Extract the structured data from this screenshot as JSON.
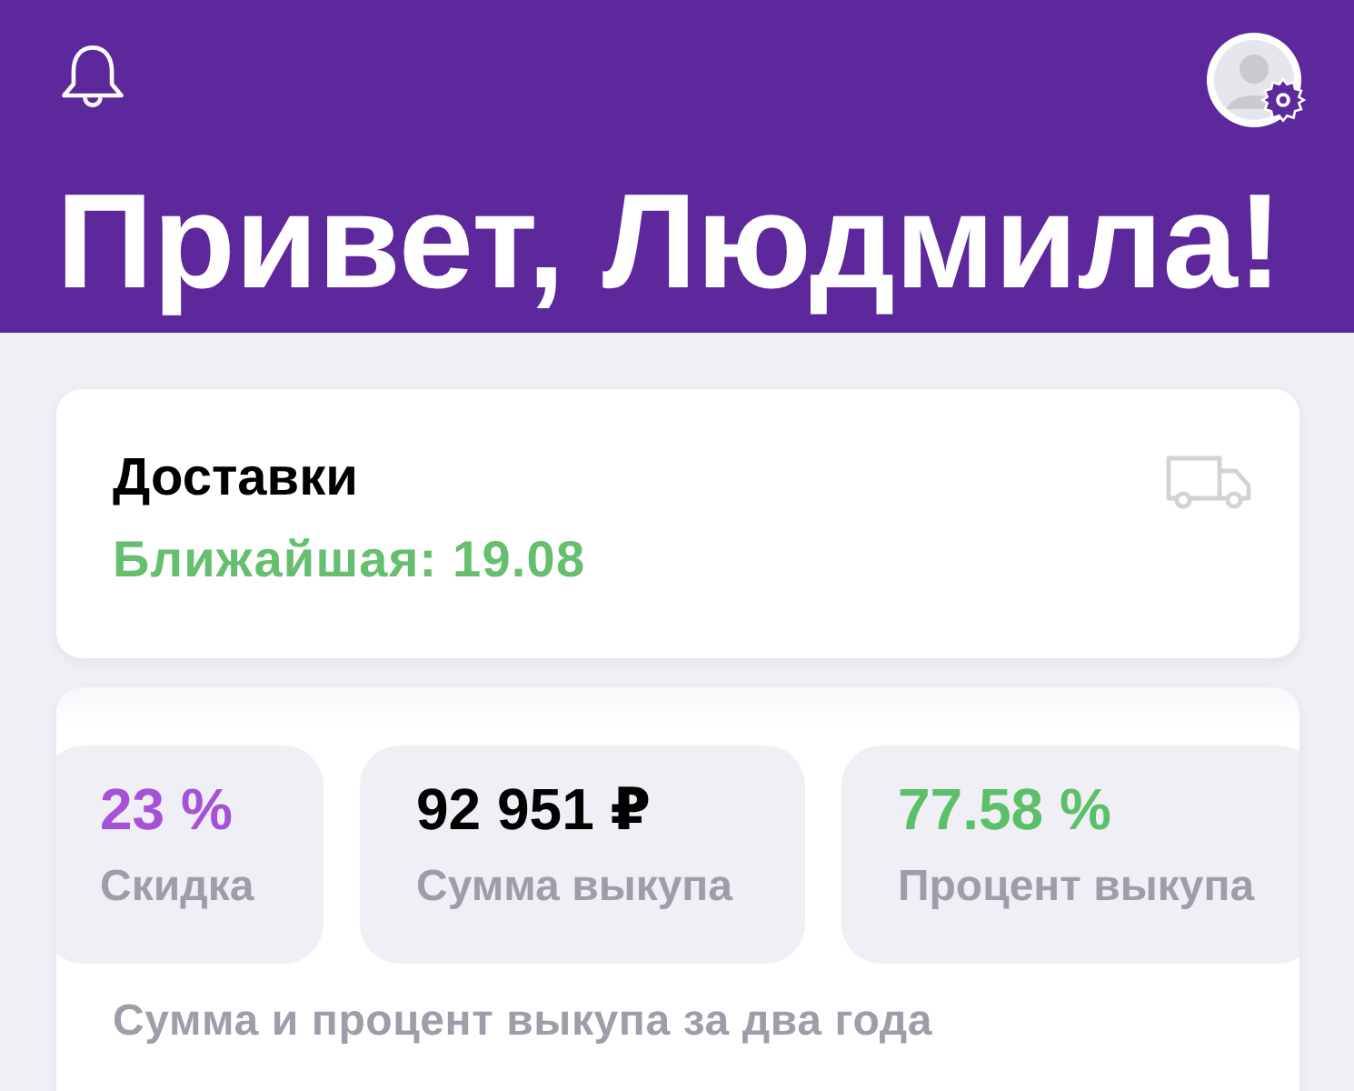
{
  "header": {
    "greeting": "Привет, Людмила!"
  },
  "delivery_card": {
    "title": "Доставки",
    "subtitle": "Ближайшая: 19.08"
  },
  "stats_card": {
    "tiles": [
      {
        "value": "23 %",
        "label": "Скидка",
        "color": "#a652d8"
      },
      {
        "value": "92 951 ₽",
        "label": "Сумма выкупа",
        "color": "#000000"
      },
      {
        "value": "77.58 %",
        "label": "Процент выкупа",
        "color": "#5cbf6a"
      }
    ],
    "caption": "Сумма и процент выкупа за два года"
  }
}
